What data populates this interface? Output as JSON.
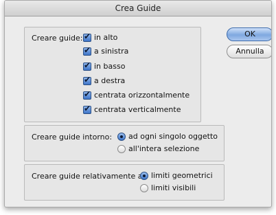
{
  "window": {
    "title": "Crea Guide"
  },
  "buttons": {
    "ok": "OK",
    "cancel": "Annulla"
  },
  "create_guides": {
    "label": "Creare guide:",
    "options": [
      {
        "label": "in alto",
        "checked": true
      },
      {
        "label": "a sinistra",
        "checked": true
      },
      {
        "label": "in basso",
        "checked": true
      },
      {
        "label": "a destra",
        "checked": true
      },
      {
        "label": "centrata orizzontalmente",
        "checked": true
      },
      {
        "label": "centrata verticalmente",
        "checked": true
      }
    ]
  },
  "around": {
    "label": "Creare guide intorno:",
    "options": [
      {
        "label": "ad ogni singolo oggetto",
        "selected": true
      },
      {
        "label": "all'intera selezione",
        "selected": false
      }
    ]
  },
  "relative": {
    "label": "Creare guide relativamente a:",
    "options": [
      {
        "label": "limiti geometrici",
        "selected": true
      },
      {
        "label": "limiti visibili",
        "selected": false
      }
    ]
  }
}
